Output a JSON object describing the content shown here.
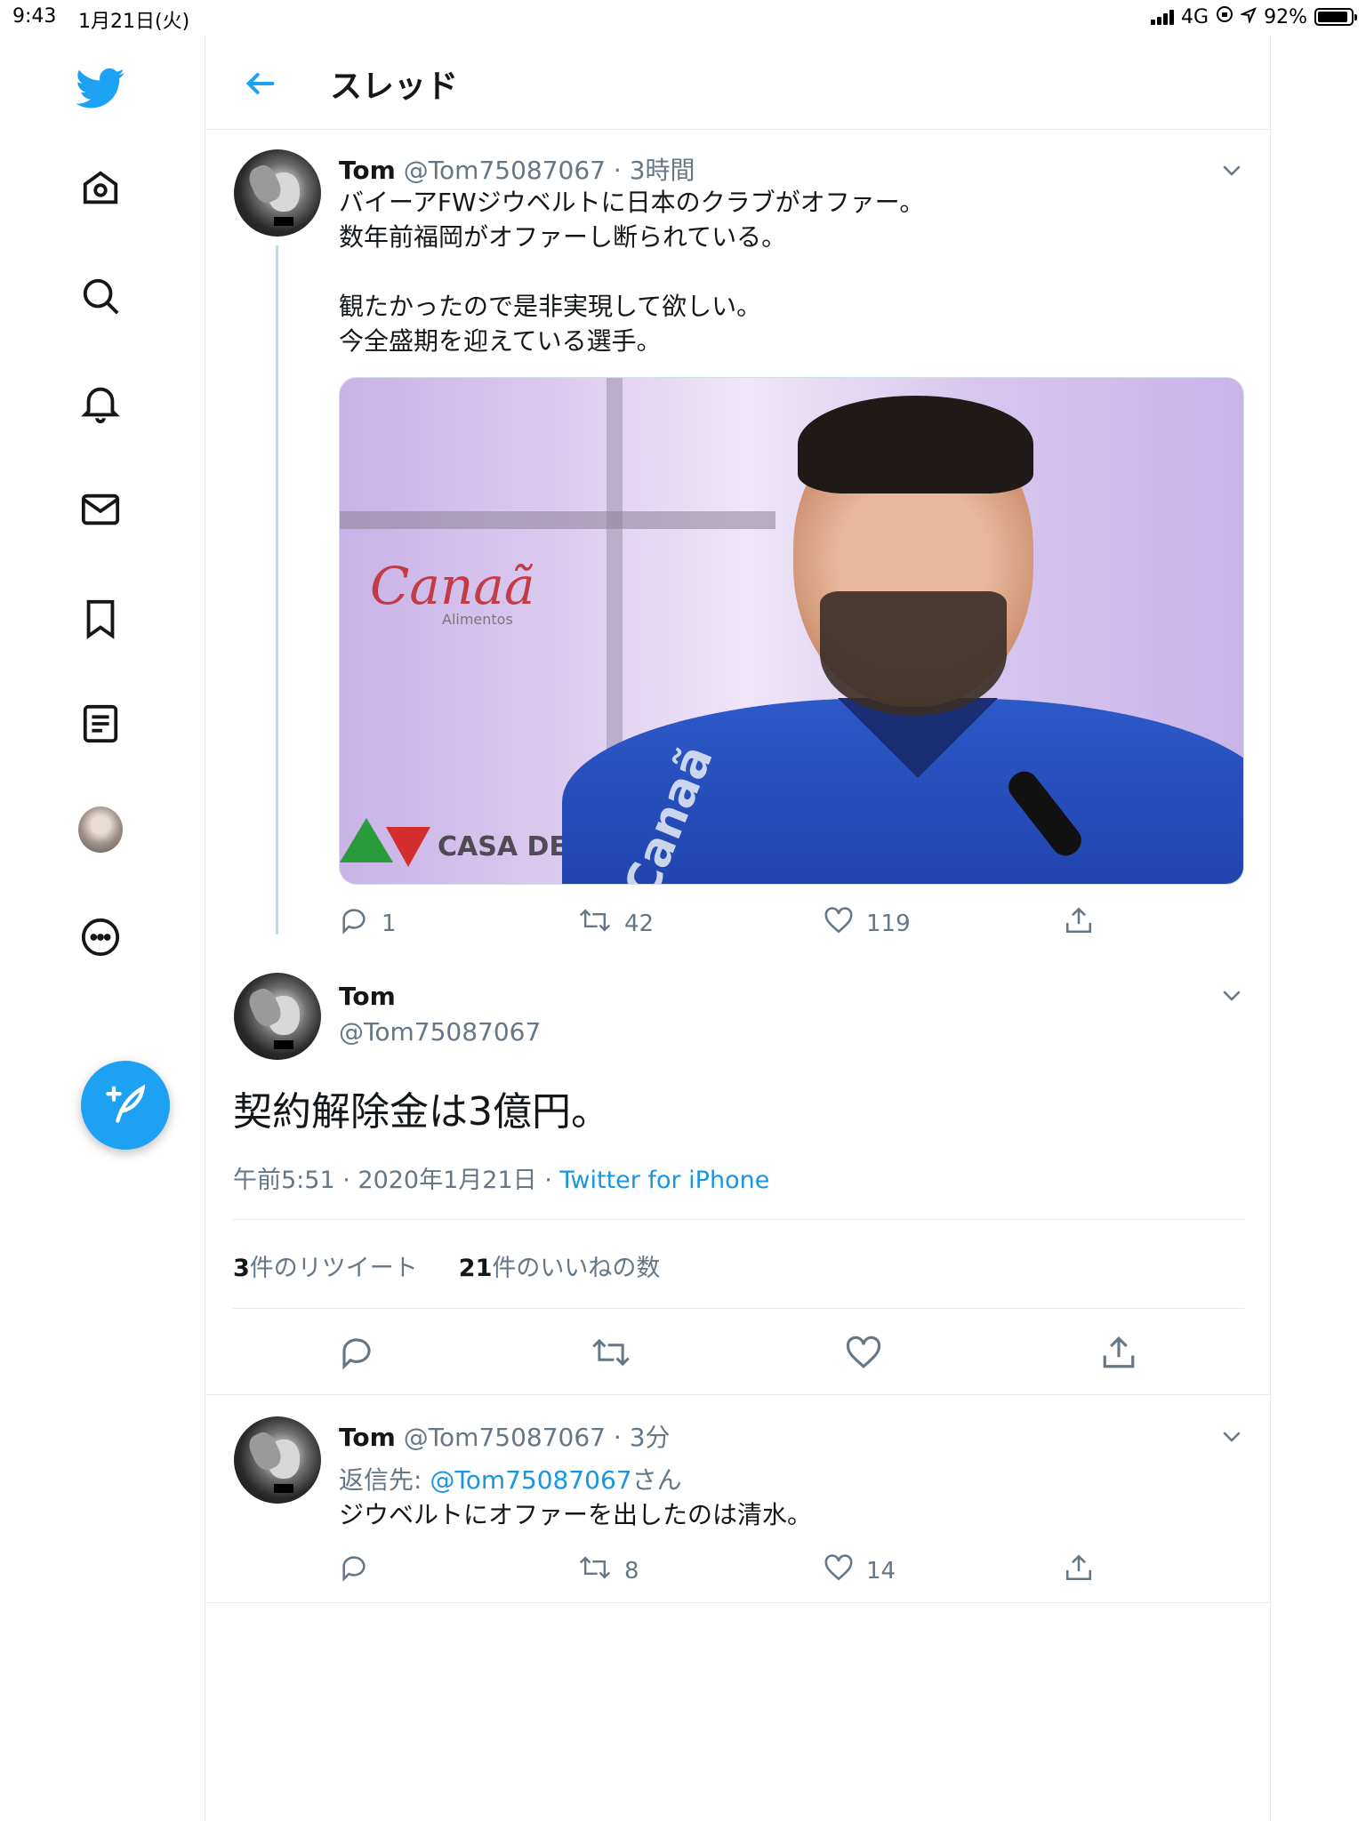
{
  "status_bar": {
    "time": "9:43",
    "date": "1月21日(火)",
    "network": "4G",
    "battery": "92%",
    "battery_level": 0.92
  },
  "sidebar": {
    "items": [
      "twitter-logo",
      "home",
      "explore",
      "notifications",
      "messages",
      "bookmarks",
      "lists",
      "profile",
      "more"
    ],
    "compose_icon": "feather-plus-icon"
  },
  "header": {
    "title": "スレッド"
  },
  "tweet1": {
    "name": "Tom",
    "handle": "@Tom75087067",
    "time": "3時間",
    "text": "バイーアFWジウベルトに日本のクラブがオファー。\n数年前福岡がオファーし断られている。\n\n観たかったので是非実現して欲しい。\n今全盛期を迎えている選手。",
    "media": {
      "logo": "Canaã",
      "logo_sub": "Alimentos",
      "sign": "CASA DE APOSTAS",
      "shirt": "Canaã"
    },
    "replies": "1",
    "retweets": "42",
    "likes": "119"
  },
  "tweet2": {
    "name": "Tom",
    "handle": "@Tom75087067",
    "text": "契約解除金は3億円。",
    "time": "午前5:51",
    "date": "2020年1月21日",
    "source": "Twitter for iPhone",
    "retweet_count": "3",
    "retweet_label": "件のリツイート",
    "like_count": "21",
    "like_label": "件のいいねの数"
  },
  "tweet3": {
    "name": "Tom",
    "handle": "@Tom75087067",
    "time": "3分",
    "reply_prefix": "返信先: ",
    "reply_to": "@Tom75087067",
    "reply_suffix": "さん",
    "text": "ジウベルトにオファーを出したのは清水。",
    "replies": "",
    "retweets": "8",
    "likes": "14"
  },
  "colors": {
    "accent": "#1da1f2",
    "text": "#14171a",
    "muted": "#657786",
    "border": "#e6ecf0"
  }
}
